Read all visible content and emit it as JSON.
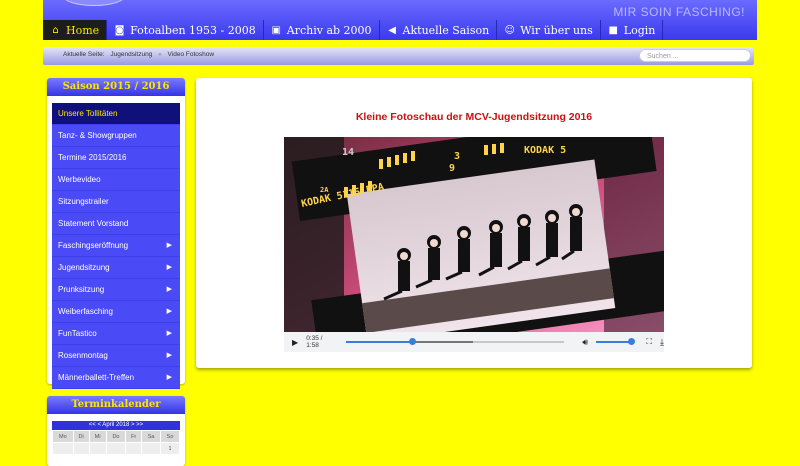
{
  "header": {
    "slogan": "MIR SOIN FASCHING!"
  },
  "nav": [
    {
      "label": "Home",
      "icon": "home-icon",
      "glyph": "⌂",
      "active": true
    },
    {
      "label": "Fotoalben 1953 - 2008",
      "icon": "camera-icon",
      "glyph": "◙",
      "active": false
    },
    {
      "label": "Archiv ab 2000",
      "icon": "calendar-icon",
      "glyph": "▣",
      "active": false
    },
    {
      "label": "Aktuelle Saison",
      "icon": "megaphone-icon",
      "glyph": "◀",
      "active": false
    },
    {
      "label": "Wir über uns",
      "icon": "smiley-icon",
      "glyph": "☺",
      "active": false
    },
    {
      "label": "Login",
      "icon": "lock-icon",
      "glyph": "■",
      "active": false
    }
  ],
  "breadcrumb": {
    "prefix": "Aktuelle Seite:",
    "items": [
      "Jugendsitzung",
      "Video Fotoshow"
    ],
    "separator": "»"
  },
  "search": {
    "placeholder": "Suchen ..."
  },
  "sidebar": {
    "season_title": "Saison 2015 / 2016",
    "menu": [
      {
        "label": "Unsere Tollitäten",
        "active": true,
        "submenu": false
      },
      {
        "label": "Tanz- & Showgruppen",
        "active": false,
        "submenu": false
      },
      {
        "label": "Termine 2015/2016",
        "active": false,
        "submenu": false
      },
      {
        "label": "Werbevideo",
        "active": false,
        "submenu": false
      },
      {
        "label": "Sitzungstrailer",
        "active": false,
        "submenu": false
      },
      {
        "label": "Statement Vorstand",
        "active": false,
        "submenu": false
      },
      {
        "label": "Faschingseröffnung",
        "active": false,
        "submenu": true
      },
      {
        "label": "Jugendsitzung",
        "active": false,
        "submenu": true
      },
      {
        "label": "Prunksitzung",
        "active": false,
        "submenu": true
      },
      {
        "label": "Weiberfasching",
        "active": false,
        "submenu": true
      },
      {
        "label": "FunTastico",
        "active": false,
        "submenu": true
      },
      {
        "label": "Rosenmontag",
        "active": false,
        "submenu": true
      },
      {
        "label": "Männerballett-Treffen",
        "active": false,
        "submenu": true
      }
    ],
    "calendar_title": "Terminkalender",
    "calendar": {
      "nav_label": "<< < April 2018 > >>",
      "weekdays": [
        "Mo",
        "Di",
        "Mi",
        "Do",
        "Fr",
        "Sa",
        "So"
      ],
      "first_row": [
        "",
        "",
        "",
        "",
        "",
        "",
        "1"
      ]
    }
  },
  "main": {
    "title": "Kleine Fotoschau der MCV-Jugendsitzung 2016",
    "video": {
      "time": "0:35 / 1:58",
      "progress_fraction": 0.3,
      "buffered_fraction": 0.58,
      "volume_fraction": 1.0,
      "film_text": [
        "KODAK 5115 PPA",
        "3",
        "9",
        "14",
        "2A",
        "KODAK 5"
      ]
    }
  },
  "colors": {
    "page_bg": "#ffff00",
    "header_blue": "#4444ee",
    "accent_yellow": "#ffe600",
    "title_red": "#cc1111"
  }
}
